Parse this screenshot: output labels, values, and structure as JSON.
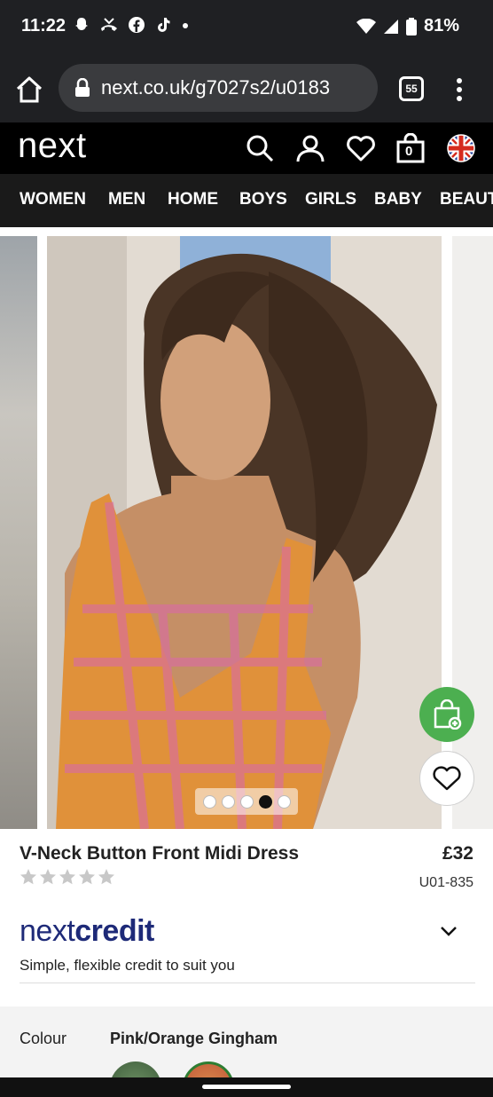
{
  "status_bar": {
    "time": "11:22",
    "battery": "81%",
    "notification_icons": [
      "snapchat-icon",
      "missed-call-icon",
      "facebook-icon",
      "tiktok-icon",
      "dot-icon"
    ]
  },
  "browser": {
    "url": "next.co.uk/g7027s2/u0183",
    "tab_count": "55"
  },
  "site": {
    "logo": "next",
    "basket_count": "0",
    "nav_items": [
      "WOMEN",
      "MEN",
      "HOME",
      "BOYS",
      "GIRLS",
      "BABY",
      "BEAUTY"
    ]
  },
  "gallery": {
    "image_count": 5,
    "active_index": 3
  },
  "product": {
    "title": "V-Neck Button Front Midi Dress",
    "price": "£32",
    "sku": "U01-835",
    "rating": 0,
    "max_rating": 5
  },
  "credit": {
    "logo_part1": "next",
    "logo_part2": "credit",
    "tagline": "Simple, flexible credit to suit you"
  },
  "colour": {
    "label": "Colour",
    "value": "Pink/Orange Gingham"
  },
  "colors": {
    "header_bg": "#000000",
    "nav_bg": "#1a1a1a",
    "credit_blue": "#1e2a78",
    "bag_green": "#4caf50"
  }
}
